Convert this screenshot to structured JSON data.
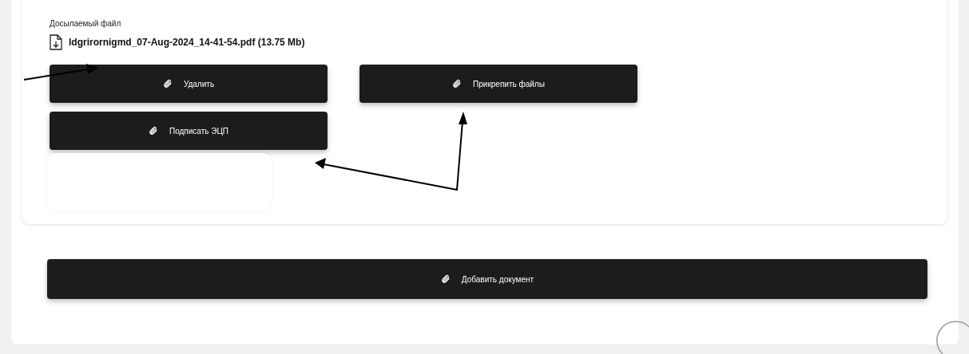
{
  "section": {
    "label": "Досылаемый файл",
    "file": {
      "name": "ldgrirornigmd_07-Aug-2024_14-41-54.pdf (13.75 Mb)"
    },
    "buttons": [
      {
        "label": "Удалить"
      },
      {
        "label": "Прикрепить файлы"
      },
      {
        "label": "Подписать ЭЦП"
      }
    ]
  },
  "add_button": {
    "label": "Добавить документ"
  }
}
